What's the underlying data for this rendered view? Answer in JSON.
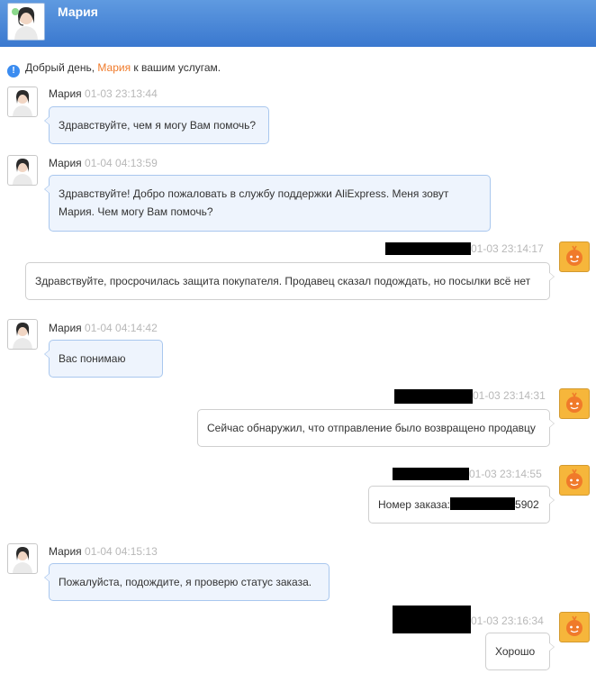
{
  "header": {
    "title": "Мария",
    "avatar_icon": "agent-headset-avatar"
  },
  "greeting": {
    "prefix": "Добрый день,",
    "agent_name": "Мария",
    "suffix": "к вашим услугам."
  },
  "messages": [
    {
      "sender": "agent",
      "name": "Мария",
      "time": "01-03 23:13:44",
      "lines": [
        "Здравствуйте, чем я могу Вам помочь?"
      ]
    },
    {
      "sender": "agent",
      "name": "Мария",
      "time": "01-04 04:13:59",
      "lines": [
        "Здравствуйте! Добро пожаловать в службу поддержки AliExpress. Меня зовут",
        "Мария. Чем могу Вам помочь?"
      ]
    },
    {
      "sender": "customer",
      "time": "01-03 23:14:17",
      "lines": [
        "Здравствуйте, просрочилась защита покупателя. Продавец сказал подождать, но посылки всё нет"
      ]
    },
    {
      "sender": "agent",
      "name": "Мария",
      "time": "01-04 04:14:42",
      "lines": [
        "Вас понимаю"
      ]
    },
    {
      "sender": "customer",
      "time": "01-03 23:14:31",
      "lines": [
        "Сейчас обнаружил, что отправление было возвращено продавцу"
      ]
    },
    {
      "sender": "customer",
      "time": "01-03 23:14:55",
      "order_prefix": "Номер заказа:",
      "order_suffix": "5902"
    },
    {
      "sender": "agent",
      "name": "Мария",
      "time": "01-04 04:15:13",
      "lines": [
        "Пожалуйста, подождите, я проверю статус заказа."
      ]
    },
    {
      "sender": "customer",
      "time": "01-03 23:16:34",
      "lines": [
        "Хорошо"
      ]
    }
  ],
  "colors": {
    "header": "#4a87d6",
    "agent_bubble": "#eef4fd",
    "agent_border": "#a9c7ee",
    "accent_name": "#f07a2a",
    "customer_avatar": "#f6b63b"
  }
}
